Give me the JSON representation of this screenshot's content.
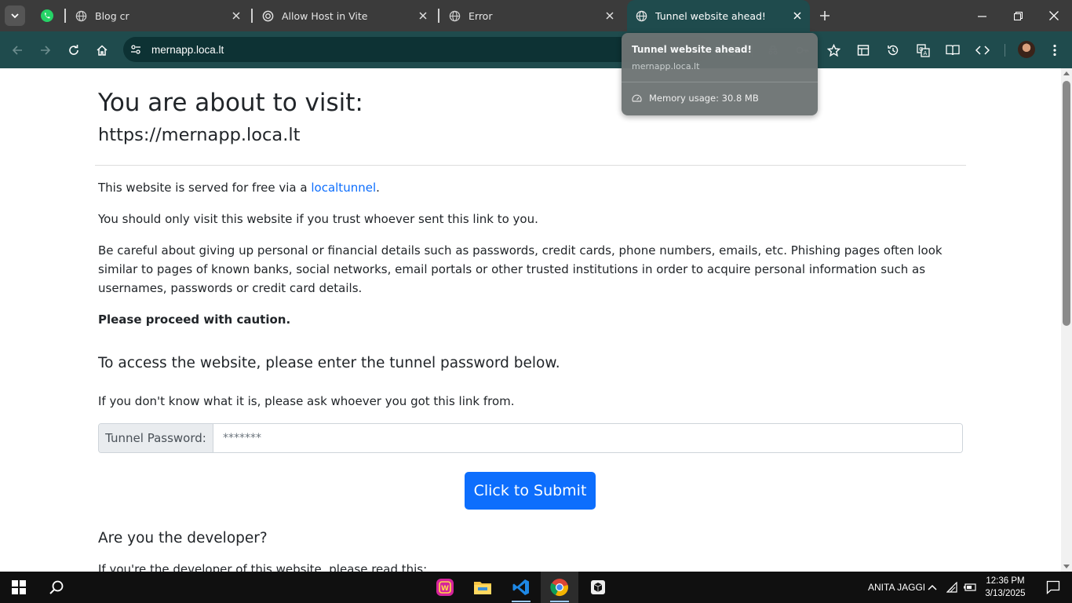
{
  "browser": {
    "tabs": [
      {
        "title": "",
        "icon": "whatsapp-icon",
        "pinned": true
      },
      {
        "title": "Blog cr",
        "icon": "globe-icon"
      },
      {
        "title": "Allow Host in Vite",
        "icon": "openai-icon"
      },
      {
        "title": "Error",
        "icon": "globe-icon"
      },
      {
        "title": "Tunnel website ahead!",
        "icon": "globe-icon",
        "active": true
      }
    ],
    "address_bar": {
      "url": "mernapp.loca.lt"
    },
    "hover_card": {
      "title": "Tunnel website ahead!",
      "host": "mernapp.loca.lt",
      "memory": "Memory usage: 30.8 MB"
    }
  },
  "page": {
    "heading": "You are about to visit:",
    "url": "https://mernapp.loca.lt",
    "intro_prefix": "This website is served for free via a ",
    "intro_link": "localtunnel",
    "intro_suffix": ".",
    "trust_text": "You should only visit this website if you trust whoever sent this link to you.",
    "warning_text": "Be careful about giving up personal or financial details such as passwords, credit cards, phone numbers, emails, etc. Phishing pages often look similar to pages of known banks, social networks, email portals or other trusted institutions in order to acquire personal information such as usernames, passwords or credit card details.",
    "caution_text": "Please proceed with caution.",
    "access_heading": "To access the website, please enter the tunnel password below.",
    "ask_text": "If you don't know what it is, please ask whoever you got this link from.",
    "password_label": "Tunnel Password:",
    "password_placeholder": "*******",
    "submit_label": "Click to Submit",
    "developer_heading": "Are you the developer?",
    "developer_text": "If you're the developer of this website, please read this:"
  },
  "taskbar": {
    "user": "ANITA JAGGI",
    "time": "12:36 PM",
    "date": "3/13/2025"
  },
  "colors": {
    "toolbar": "#1f4b4d",
    "tabstrip": "#3b3b3b",
    "primary_button": "#0d6efd",
    "link": "#0d6efd"
  }
}
